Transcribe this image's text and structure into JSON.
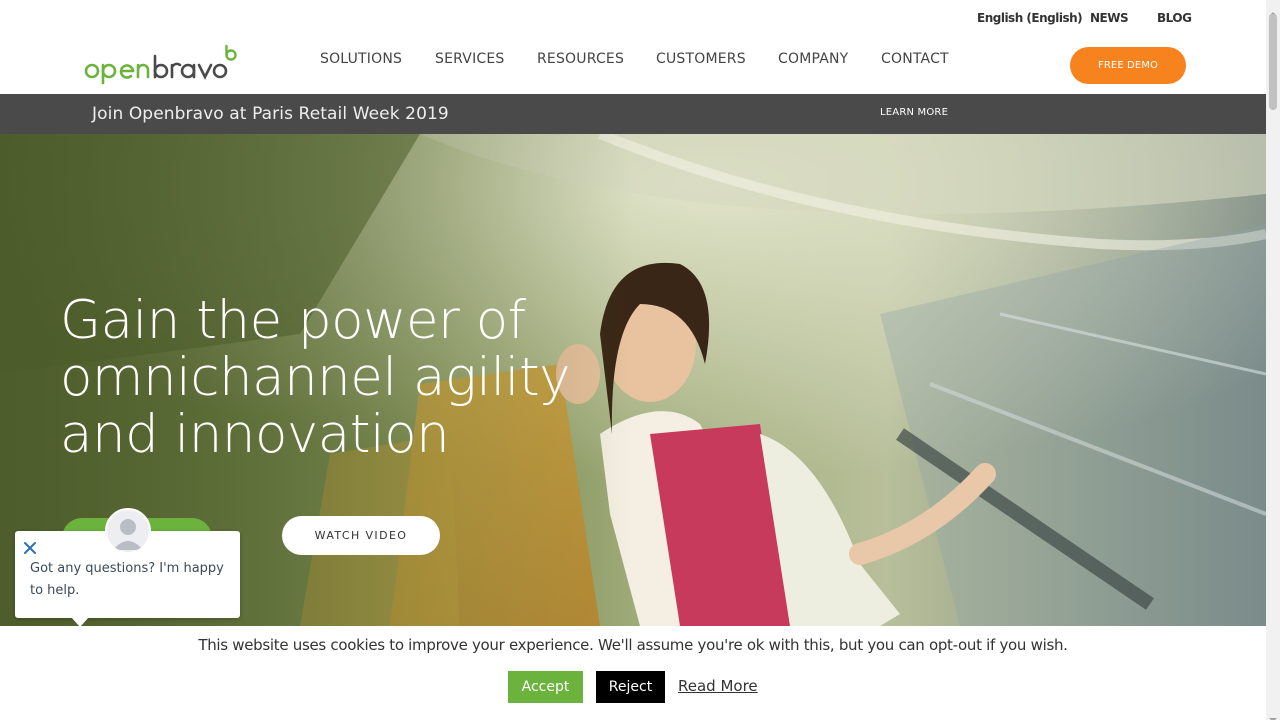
{
  "util_nav": {
    "language": "English (English)",
    "news": "NEWS",
    "blog": "BLOG"
  },
  "logo": {
    "text": "openbravo"
  },
  "nav": {
    "items": [
      {
        "label": "SOLUTIONS"
      },
      {
        "label": "SERVICES"
      },
      {
        "label": "RESOURCES"
      },
      {
        "label": "CUSTOMERS"
      },
      {
        "label": "COMPANY"
      },
      {
        "label": "CONTACT"
      }
    ],
    "cta": "FREE DEMO"
  },
  "announcement": {
    "text": "Join Openbravo at Paris Retail Week 2019",
    "link": "LEARN MORE"
  },
  "hero": {
    "headline_lines": [
      "Gain the power of",
      "omnichannel agility",
      "and innovation"
    ],
    "watch_video": "WATCH VIDEO"
  },
  "chat": {
    "message": "Got any questions? I'm happy to help."
  },
  "cookie": {
    "text": "This website uses cookies to improve your experience. We'll assume you're ok with this, but you can opt-out if you wish.",
    "accept": "Accept",
    "reject": "Reject",
    "read_more": "Read More"
  },
  "colors": {
    "brand_green": "#6cb33e",
    "brand_orange": "#f7831f",
    "announce_bg": "#4a4a4a"
  }
}
